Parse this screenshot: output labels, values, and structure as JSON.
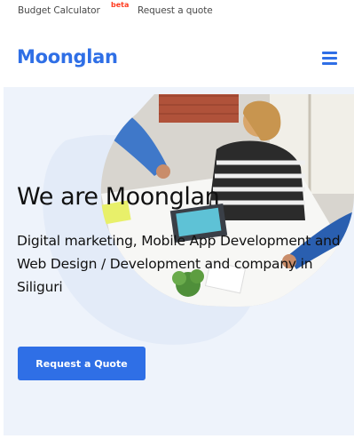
{
  "topbar": {
    "budget_label": "Budget Calculator",
    "beta_badge": "beta",
    "quote_link": "Request a quote"
  },
  "header": {
    "logo": "Moonglan",
    "menu_icon": "hamburger-menu-icon"
  },
  "hero": {
    "title": "We are Moonglan",
    "subtitle": "Digital marketing, Mobile App Development and Web Design / Development and company in Siliguri",
    "cta_label": "Request a Quote",
    "image": "office-team-meeting-photo"
  },
  "colors": {
    "brand": "#2f6fe6",
    "beta": "#ff3b1f",
    "hero_bg": "#eef3fb"
  }
}
